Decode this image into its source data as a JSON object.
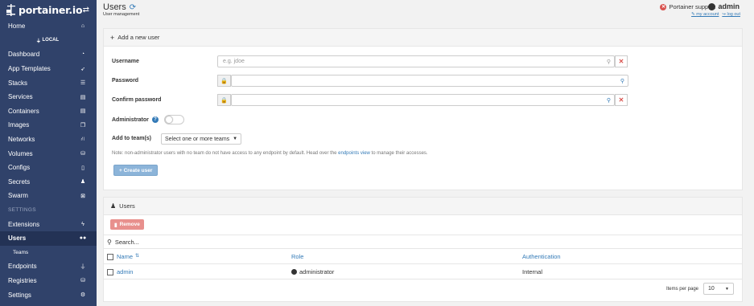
{
  "sidebar": {
    "logo_text": "portainer.io",
    "endpoint": "LOCAL",
    "items": [
      {
        "label": "Home",
        "icon": "home-icon",
        "glyph": "⌂"
      },
      {
        "label": "Dashboard",
        "icon": "tachometer-icon",
        "glyph": "◔"
      },
      {
        "label": "App Templates",
        "icon": "rocket-icon",
        "glyph": "➶"
      },
      {
        "label": "Stacks",
        "icon": "list-icon",
        "glyph": "☰"
      },
      {
        "label": "Services",
        "icon": "services-icon",
        "glyph": "▤"
      },
      {
        "label": "Containers",
        "icon": "server-icon",
        "glyph": "▤"
      },
      {
        "label": "Images",
        "icon": "clone-icon",
        "glyph": "❐"
      },
      {
        "label": "Networks",
        "icon": "sitemap-icon",
        "glyph": "⛙"
      },
      {
        "label": "Volumes",
        "icon": "cubes-icon",
        "glyph": "⛁"
      },
      {
        "label": "Configs",
        "icon": "file-code-icon",
        "glyph": "▯"
      },
      {
        "label": "Secrets",
        "icon": "user-secret-icon",
        "glyph": "♟"
      },
      {
        "label": "Swarm",
        "icon": "object-group-icon",
        "glyph": "⊠"
      }
    ],
    "settings_label": "SETTINGS",
    "settings_items": [
      {
        "label": "Extensions",
        "icon": "bolt-icon",
        "glyph": "ϟ"
      },
      {
        "label": "Users",
        "icon": "users-icon",
        "glyph": "👥"
      },
      {
        "label": "Teams"
      },
      {
        "label": "Endpoints",
        "icon": "plug-icon",
        "glyph": "⏚"
      },
      {
        "label": "Registries",
        "icon": "database-icon",
        "glyph": "⛁"
      },
      {
        "label": "Settings",
        "icon": "cogs-icon",
        "glyph": "⚙"
      }
    ]
  },
  "header": {
    "title": "Users",
    "breadcrumb": "User management",
    "support": "Portainer support",
    "user": "admin",
    "my_account": "my account",
    "log_out": "log out"
  },
  "form": {
    "panel_title": "Add a new user",
    "username_label": "Username",
    "username_placeholder": "e.g. jdoe",
    "password_label": "Password",
    "confirm_label": "Confirm password",
    "admin_label": "Administrator",
    "admin_enabled": false,
    "teams_label": "Add to team(s)",
    "teams_select": "Select one or more teams",
    "note_before": "Note: non-administrator users with no team do not have access to any endpoint by default. Head over the ",
    "note_link": "endpoints view",
    "note_after": " to manage their accesses.",
    "create_button": "+ Create user"
  },
  "users": {
    "panel_title": "Users",
    "remove_button": "Remove",
    "search_placeholder": "Search...",
    "columns": [
      "Name",
      "Role",
      "Authentication"
    ],
    "rows": [
      {
        "name": "admin",
        "role": "administrator",
        "auth": "Internal"
      }
    ],
    "items_per_page_label": "Items per page",
    "items_per_page": "10"
  },
  "colors": {
    "sidebar": "#30426a",
    "sidebar_active": "#233255",
    "link": "#337ab7",
    "danger": "#d9534f"
  }
}
